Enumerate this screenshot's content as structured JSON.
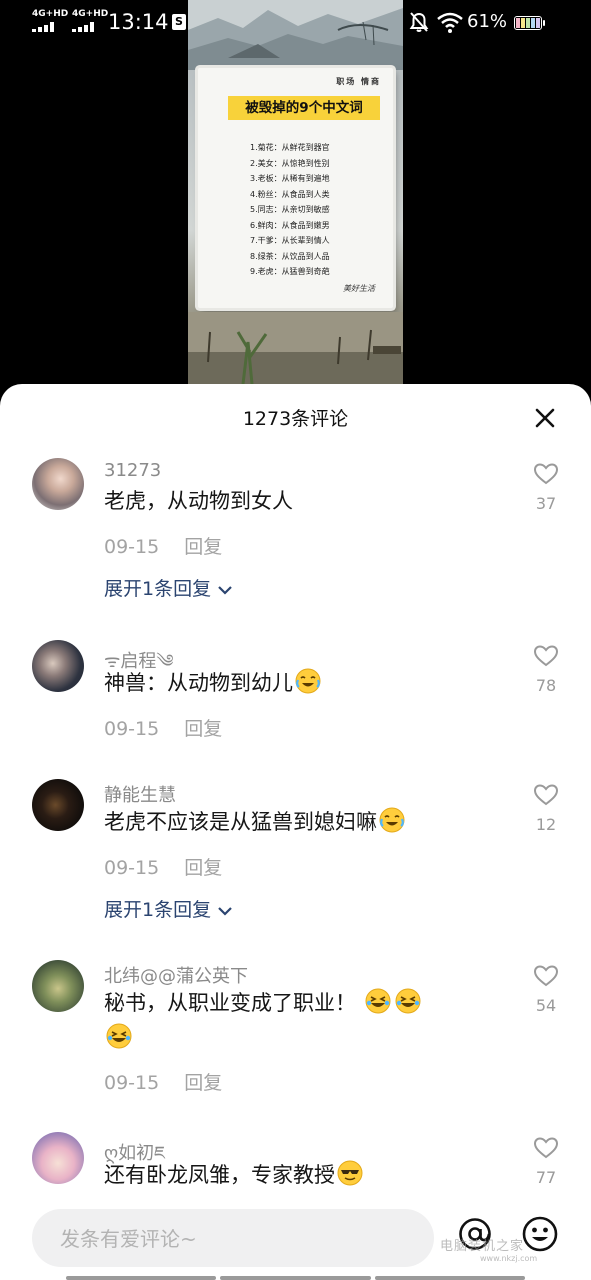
{
  "status_bar": {
    "sim1": "4G+HD",
    "sim2": "4G+HD",
    "time": "13:14",
    "app_badge": "S",
    "battery": "61%"
  },
  "video": {
    "brand": "职场 情商",
    "title": "被毁掉的9个中文词",
    "items": [
      "1.菊花：从鲜花到器官",
      "2.美女：从惊艳到性别",
      "3.老板：从稀有到遍地",
      "4.粉丝：从食品到人类",
      "5.同志：从亲切到敏感",
      "6.鲜肉：从食品到嫩男",
      "7.干爹：从长辈到情人",
      "8.绿茶：从饮品到人品",
      "9.老虎：从猛兽到奇葩"
    ],
    "signature": "美好生活"
  },
  "comments_header": {
    "title": "1273条评论"
  },
  "comments": [
    {
      "user": "31273",
      "text": "老虎，从动物到女人",
      "emoji_count": 0,
      "date": "09-15",
      "reply": "回复",
      "likes": "37",
      "expand": "展开1条回复"
    },
    {
      "user": "ᯤ启程༄",
      "text": "神兽：从动物到幼儿",
      "emoji_count": 1,
      "date": "09-15",
      "reply": "回复",
      "likes": "78"
    },
    {
      "user": "静能生慧",
      "text": "老虎不应该是从猛兽到媳妇嘛",
      "emoji_count": 1,
      "date": "09-15",
      "reply": "回复",
      "likes": "12",
      "expand": "展开1条回复"
    },
    {
      "user": "北纬@@蒲公英下",
      "text": "秘书，从职业变成了职业！",
      "emoji_count": 3,
      "date": "09-15",
      "reply": "回复",
      "likes": "54"
    },
    {
      "user": "ღ如初ཇ",
      "text": "还有卧龙凤雏，专家教授",
      "emoji_count": 1,
      "date": "",
      "reply": "",
      "likes": "77"
    }
  ],
  "input": {
    "placeholder": "发条有爱评论~"
  },
  "icons": {
    "close": "close-icon",
    "heart": "heart-outline-icon",
    "at": "at-sign-icon",
    "emoji": "smiley-face-icon",
    "chevron": "chevron-down-icon"
  },
  "watermark": {
    "line1": "电脑装机之家",
    "line2": "www.nkzj.com"
  },
  "colors": {
    "link": "#2b4470",
    "meta": "#a3a3a3",
    "title_highlight": "#f8d23a"
  }
}
